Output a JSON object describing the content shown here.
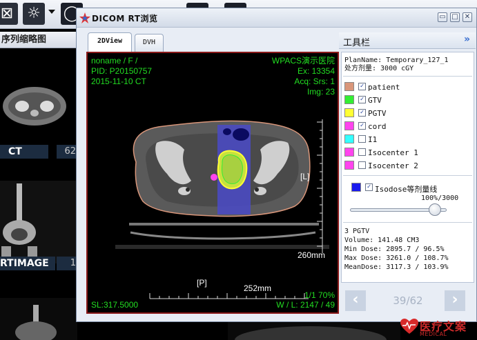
{
  "background_app": {
    "series_panel_title": "序列缩略图",
    "thumbnails": [
      {
        "label": "CT",
        "number": "62"
      },
      {
        "label": "RTIMAGE",
        "number": "1"
      }
    ]
  },
  "dialog": {
    "title": "DICOM RT浏览",
    "tabs": [
      {
        "label": "2DView"
      },
      {
        "label": "DVH"
      }
    ],
    "viewer": {
      "patient_line": "noname / F /",
      "pid_line": "PID: P20150757",
      "date_line": "2015-11-10 CT",
      "hospital": "WPACS演示医院",
      "ex_line": "Ex: 13354",
      "acq_line": "Acq:  Srs: 1",
      "img_line": "Img: 23",
      "orientation_right": "[L]",
      "orientation_bottom": "[P]",
      "scale_vertical": "260mm",
      "scale_horizontal": "252mm",
      "page_zoom": "1/1   70%",
      "slice_location": "SL:317.5000",
      "window_level": "W / L:  2147 / 49"
    },
    "toolbar_panel": {
      "title": "工具栏",
      "collapse_glyph": "»",
      "plan_name": "PlanName: Temporary_127_1",
      "prescription": "处方剂量: 3000 cGY",
      "legend": [
        {
          "label": "patient",
          "color": "#d9967a",
          "checked": true
        },
        {
          "label": "GTV",
          "color": "#33ee33",
          "checked": true
        },
        {
          "label": "PGTV",
          "color": "#ffff33",
          "checked": true
        },
        {
          "label": "cord",
          "color": "#ff44ee",
          "checked": true
        },
        {
          "label": "I1",
          "color": "#33ffff",
          "checked": false
        },
        {
          "label": "Isocenter 1",
          "color": "#ff44ee",
          "checked": false
        },
        {
          "label": "Isocenter 2",
          "color": "#ff44ee",
          "checked": false
        }
      ],
      "isodose": {
        "label": "Isodose等剂量线",
        "color": "#1a1aee",
        "checked": true
      },
      "isodose_value": "100%/3000",
      "isodose_level_fraction": 0.9,
      "stats": {
        "name": "3 PGTV",
        "volume": "Volume: 141.48 CM3",
        "min_dose": "Min Dose: 2895.7 / 96.5%",
        "max_dose": "Max Dose: 3261.0 / 108.7%",
        "mean_dose": "MeanDose: 3117.3 / 103.9%"
      },
      "nav": {
        "prev": "‹",
        "next": "›",
        "counter": "39/62"
      }
    }
  },
  "watermark": {
    "text": "医疗文案",
    "sub": "MEDICAL"
  }
}
